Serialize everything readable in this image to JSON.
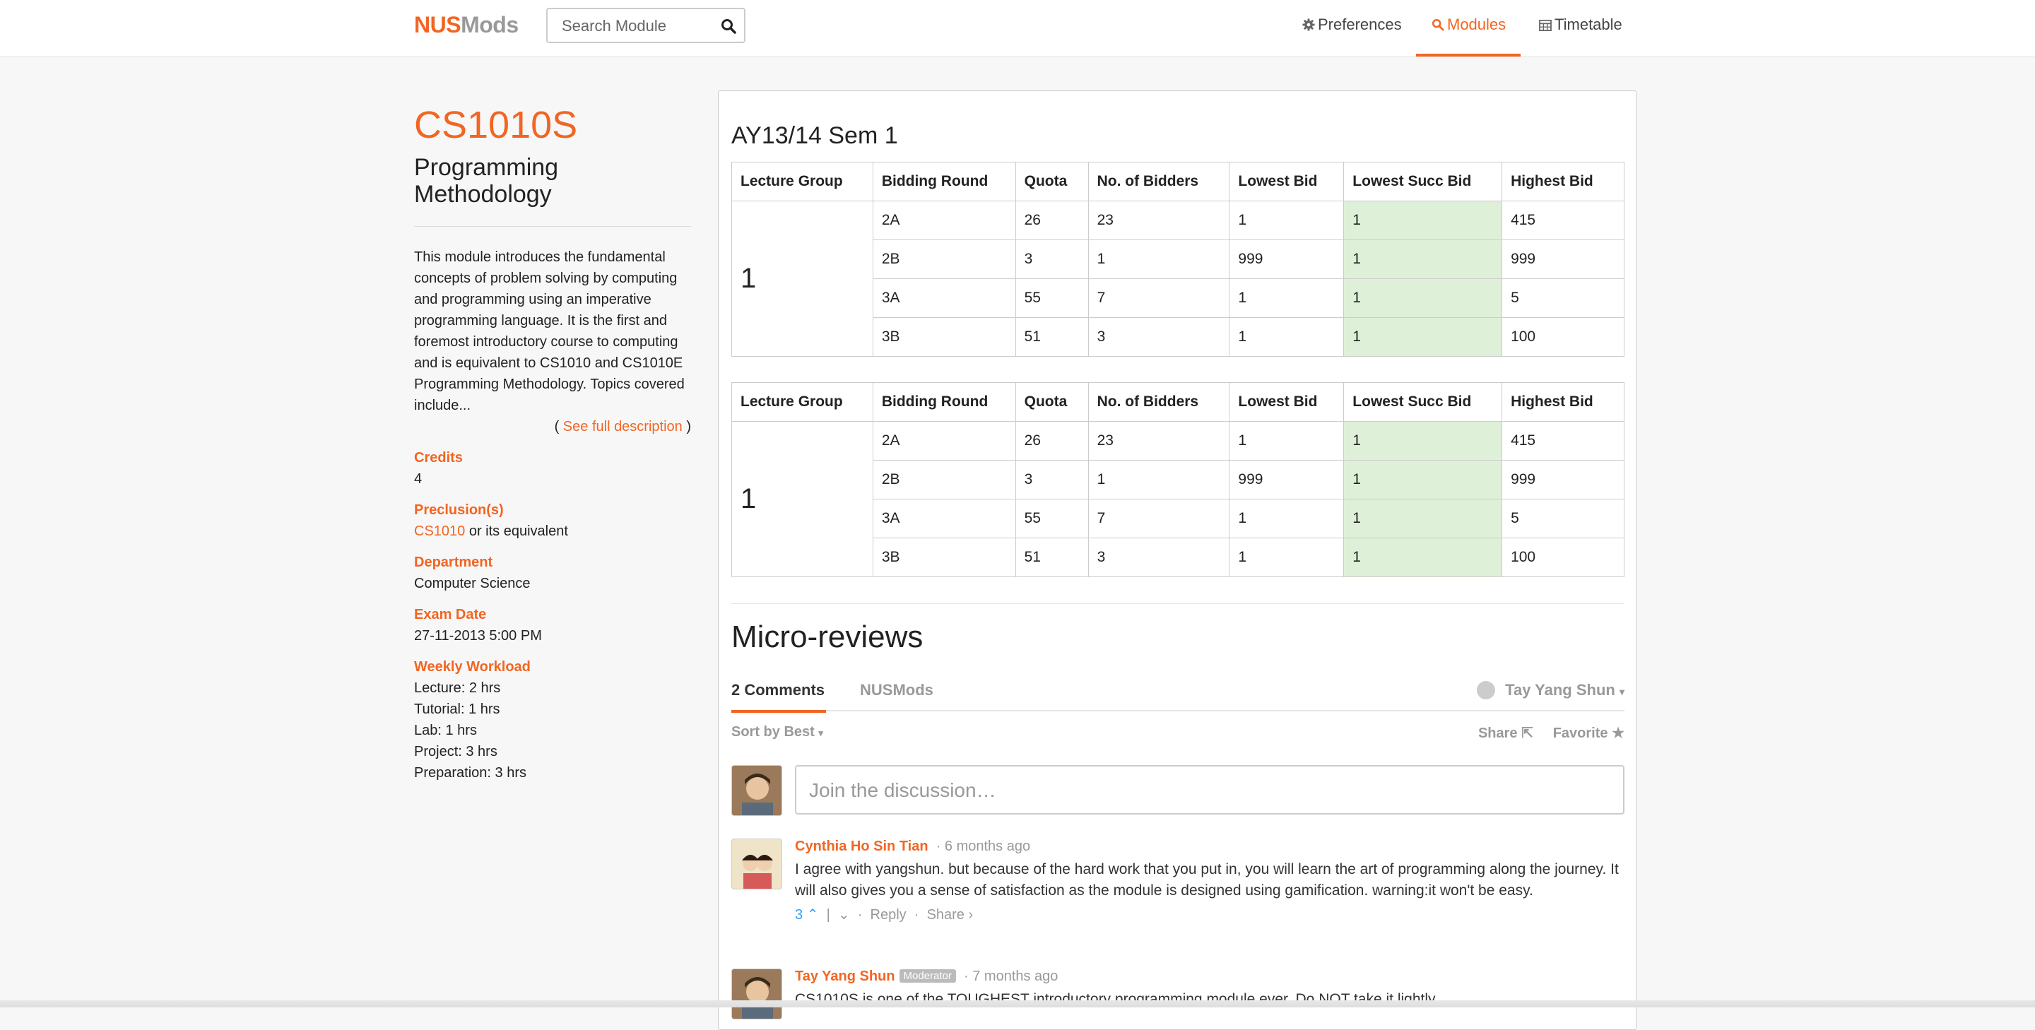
{
  "nav": {
    "logo_nus": "NUS",
    "logo_mods": "Mods",
    "search_placeholder": "Search Module",
    "preferences": "Preferences",
    "modules": "Modules",
    "timetable": "Timetable",
    "accent": "#f26522"
  },
  "module": {
    "code": "CS1010S",
    "title": "Programming Methodology",
    "description": "This module introduces the fundamental concepts of problem solving by computing and programming using an imperative programming language. It is the first and foremost introductory course to computing and is equivalent to CS1010 and CS1010E Programming Methodology. Topics covered include...",
    "see_full_open": "( ",
    "see_full": "See full description",
    "see_full_close": " )",
    "credits_label": "Credits",
    "credits": "4",
    "preclusion_label": "Preclusion(s)",
    "preclusion_link": "CS1010",
    "preclusion_rest": " or its equivalent",
    "department_label": "Department",
    "department": "Computer Science",
    "exam_label": "Exam Date",
    "exam": "27-11-2013 5:00 PM",
    "workload_label": "Weekly Workload",
    "workload": [
      "Lecture: 2 hrs",
      "Tutorial: 1 hrs",
      "Lab: 1 hrs",
      "Project: 3 hrs",
      "Preparation: 3 hrs"
    ]
  },
  "bidding": {
    "semester": "AY13/14 Sem 1",
    "headers": [
      "Lecture Group",
      "Bidding Round",
      "Quota",
      "No. of Bidders",
      "Lowest Bid",
      "Lowest Succ Bid",
      "Highest Bid"
    ],
    "tables": [
      {
        "group": "1",
        "rows": [
          [
            "2A",
            "26",
            "23",
            "1",
            "1",
            "415"
          ],
          [
            "2B",
            "3",
            "1",
            "999",
            "1",
            "999"
          ],
          [
            "3A",
            "55",
            "7",
            "1",
            "1",
            "5"
          ],
          [
            "3B",
            "51",
            "3",
            "1",
            "1",
            "100"
          ]
        ]
      },
      {
        "group": "1",
        "rows": [
          [
            "2A",
            "26",
            "23",
            "1",
            "1",
            "415"
          ],
          [
            "2B",
            "3",
            "1",
            "999",
            "1",
            "999"
          ],
          [
            "3A",
            "55",
            "7",
            "1",
            "1",
            "5"
          ],
          [
            "3B",
            "51",
            "3",
            "1",
            "1",
            "100"
          ]
        ]
      }
    ]
  },
  "reviews": {
    "title": "Micro-reviews",
    "tab_comments": "2 Comments",
    "tab_site": "NUSMods",
    "user": "Tay Yang Shun",
    "sort": "Sort by Best",
    "share": "Share",
    "favorite": "Favorite",
    "join_placeholder": "Join the discussion…",
    "comments": [
      {
        "author": "Cynthia Ho Sin Tian",
        "time": "6 months ago",
        "text": "I agree with yangshun. but because of the hard work that you put in, you will learn the art of programming along the journey. It will also gives you a sense of satisfaction as the module is designed using gamification. warning:it won't be easy.",
        "votes": "3",
        "reply": "Reply",
        "share": "Share ›"
      },
      {
        "author": "Tay Yang Shun",
        "badge": "Moderator",
        "time": "7 months ago",
        "text": "CS1010S is one of the TOUGHEST introductory programming module ever. Do NOT take it lightly."
      }
    ]
  }
}
